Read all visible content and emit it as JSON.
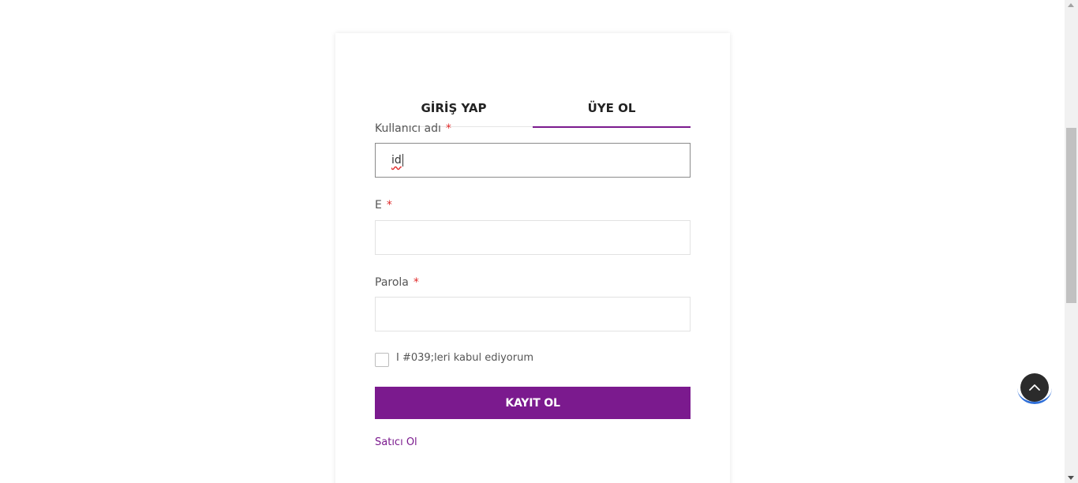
{
  "tabs": {
    "login": "GİRİŞ YAP",
    "register": "ÜYE OL",
    "active": "register"
  },
  "form": {
    "username": {
      "label": "Kullanıcı adı",
      "required_mark": "*",
      "value": "id"
    },
    "email": {
      "label": "E",
      "required_mark": "*",
      "value": ""
    },
    "password": {
      "label": "Parola",
      "required_mark": "*",
      "value": ""
    },
    "terms": {
      "label": "I #039;leri kabul ediyorum",
      "checked": false
    },
    "submit_label": "KAYIT OL",
    "seller_link": "Satıcı Ol"
  },
  "colors": {
    "accent": "#7b1a8e",
    "required": "#e02b2b",
    "back_to_top": "#2b2b2b",
    "back_to_top_ring": "#2f6fd8"
  },
  "icons": {
    "back_to_top": "chevron-up-icon"
  }
}
